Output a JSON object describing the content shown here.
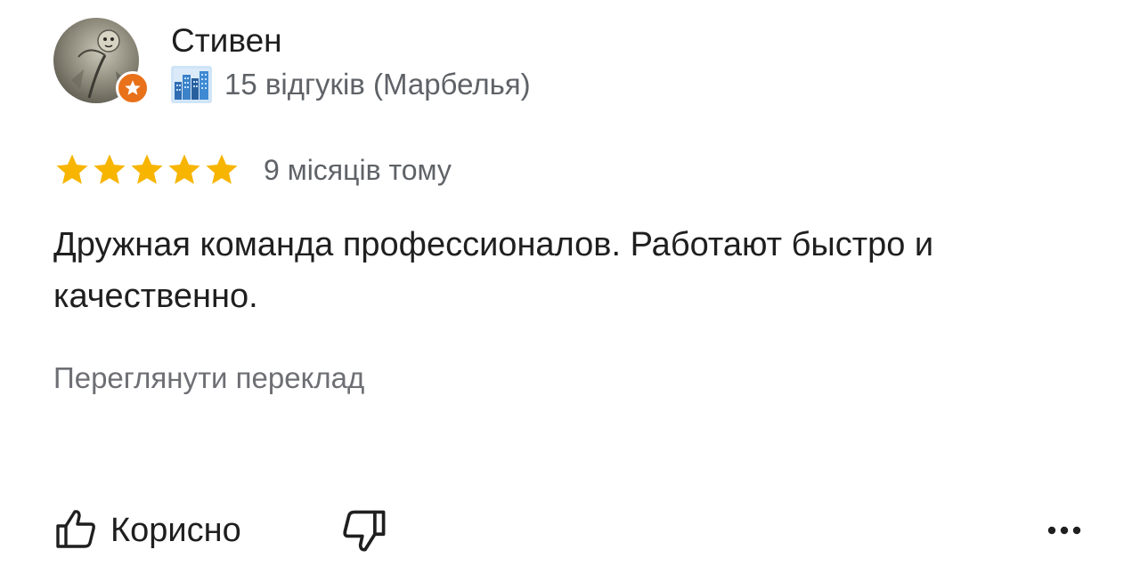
{
  "author": {
    "name": "Стивен",
    "avatar_icon": "user-avatar-photo",
    "badge_icon": "local-guide-star-icon",
    "badge_color": "#e8711a",
    "profile_icon": "cityscape-icon",
    "reviews_info": "15 відгуків (Марбелья)"
  },
  "rating": {
    "stars": 5,
    "max_stars": 5,
    "star_color": "#f7b500",
    "time_ago": "9 місяців тому"
  },
  "review": {
    "text": "Дружная команда профессионалов. Работают быстро и качественно."
  },
  "translate": {
    "label": "Переглянути переклад"
  },
  "actions": {
    "helpful_label": "Корисно",
    "helpful_icon": "thumb-up-icon",
    "dislike_icon": "thumb-down-icon",
    "more_icon": "more-horizontal-icon"
  }
}
